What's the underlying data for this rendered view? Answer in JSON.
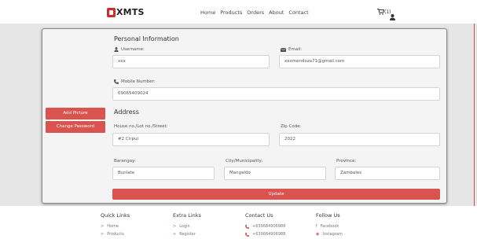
{
  "brand": {
    "name": "XMTS"
  },
  "nav": {
    "links": [
      "Home",
      "Products",
      "Orders",
      "About",
      "Contact"
    ],
    "cart_count": "(1)"
  },
  "sidebar": {
    "add_picture": "Add Picture",
    "change_password": "Change Password"
  },
  "personal": {
    "title": "Personal Information",
    "username_label": "Username:",
    "username_value": "xxx",
    "email_label": "Email:",
    "email_value": "xxxmendoza71@gmail.com",
    "mobile_label": "Mobile Number:",
    "mobile_value": "09065409024"
  },
  "address": {
    "title": "Address",
    "street_label": "House no./Lot no./Street:",
    "street_value": "#2 Cirpul",
    "zip_label": "Zip Code:",
    "zip_value": "2022",
    "barangay_label": "Barangay:",
    "barangay_value": "Bunlate",
    "city_label": "City/Municipality:",
    "city_value": "Mangaldo",
    "province_label": "Province:",
    "province_value": "Zambales"
  },
  "update_label": "Update",
  "footer": {
    "quick": {
      "title": "Quick Links",
      "items": [
        "Home",
        "Products"
      ]
    },
    "extra": {
      "title": "Extra Links",
      "items": [
        "Login",
        "Register"
      ]
    },
    "contact": {
      "title": "Contact Us",
      "items": [
        "+639684906988",
        "+639684906988"
      ]
    },
    "follow": {
      "title": "Follow Us",
      "items": [
        "Facebook",
        "Instagram"
      ]
    }
  },
  "colors": {
    "accent": "#d9534f",
    "backdrop": "#e6e6e6"
  }
}
